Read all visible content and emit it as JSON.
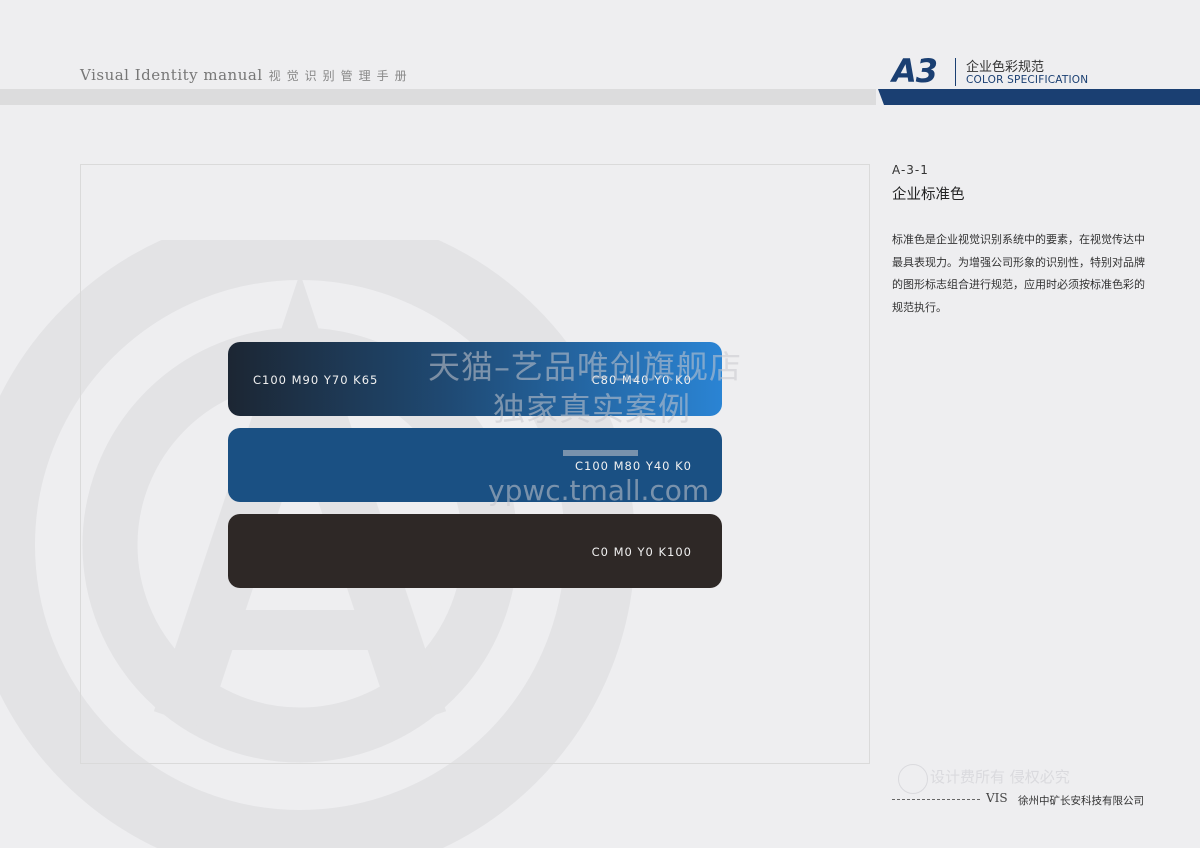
{
  "header": {
    "title_en": "Visual Identity  manual",
    "title_cn": "视觉识别管理手册",
    "section_code": "A3",
    "section_cn": "企业色彩规范",
    "section_en": "COLOR SPECIFICATION"
  },
  "content": {
    "section_number": "A-3-1",
    "section_title": "企业标准色",
    "description": "标准色是企业视觉识别系统中的要素，在视觉传达中最具表现力。为增强公司形象的识别性，特别对品牌的图形标志组合进行规范，应用时必须按标准色彩的规范执行。"
  },
  "color_bars": [
    {
      "label_left": "C100 M90 Y70 K65",
      "label_right": "C80 M40 Y0 K0",
      "colors": [
        "#1c2633",
        "#2a84d4"
      ]
    },
    {
      "label_right": "C100 M80 Y40 K0",
      "colors": [
        "#1a5083"
      ]
    },
    {
      "label_right": "C0 M0 Y0 K100",
      "colors": [
        "#2e2826"
      ]
    }
  ],
  "watermark": {
    "line1": "天猫–艺品唯创旗舰店",
    "line2": "独家真实案例",
    "line3": "ypwc.tmall.com",
    "line4": "设计费所有 侵权必究"
  },
  "footer": {
    "vis": "VIS",
    "company": "徐州中矿长安科技有限公司"
  },
  "colors": {
    "brand_blue": "#1a3f72",
    "page_bg": "#eeeef0"
  }
}
